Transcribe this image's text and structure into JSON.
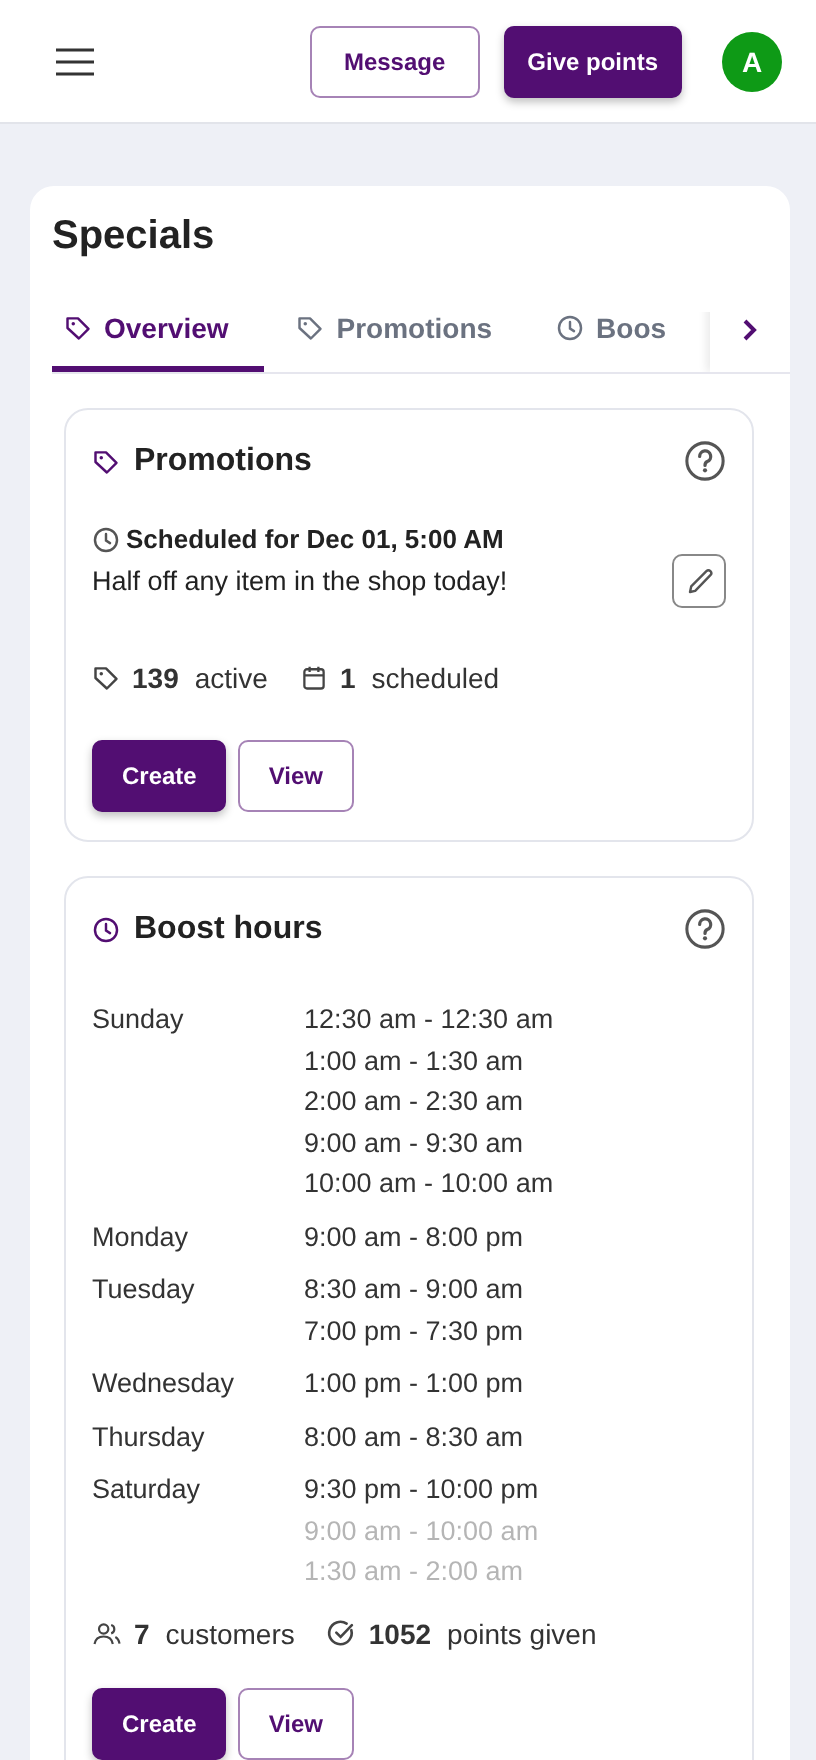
{
  "header": {
    "buttons": [
      {
        "label": "Message",
        "kind": "outline"
      },
      {
        "label": "Give points",
        "kind": "filled"
      }
    ],
    "avatar": "A"
  },
  "title": "Specials",
  "tabs": [
    {
      "label": "Overview",
      "selected": true
    },
    {
      "label": "Promotions",
      "selected": false
    },
    {
      "label": "Boos",
      "selected": false
    }
  ],
  "promotions": {
    "title": "Promotions",
    "scheduled": "Scheduled for Dec 01, 5:00 AM",
    "message": "Half off any item in the shop today!",
    "stats": [
      {
        "count": "139",
        "label": "active"
      },
      {
        "count": "1",
        "label": "scheduled"
      }
    ],
    "buttons": [
      {
        "label": "Create",
        "kind": "filled"
      },
      {
        "label": "View",
        "kind": "outline"
      }
    ]
  },
  "boost_hours": {
    "title": "Boost hours",
    "days": [
      {
        "day": "Sunday",
        "slots": [
          {
            "time": "12:30 am - 12:30 am",
            "faded": false
          },
          {
            "time": "1:00 am - 1:30 am",
            "faded": false
          },
          {
            "time": "2:00 am - 2:30 am",
            "faded": false
          },
          {
            "time": "9:00 am - 9:30 am",
            "faded": false
          },
          {
            "time": "10:00 am - 10:00 am",
            "faded": false
          }
        ]
      },
      {
        "day": "Monday",
        "slots": [
          {
            "time": "9:00 am - 8:00 pm",
            "faded": false
          }
        ]
      },
      {
        "day": "Tuesday",
        "slots": [
          {
            "time": "8:30 am - 9:00 am",
            "faded": false
          },
          {
            "time": "7:00 pm - 7:30 pm",
            "faded": false
          }
        ]
      },
      {
        "day": "Wednesday",
        "slots": [
          {
            "time": "1:00 pm - 1:00 pm",
            "faded": false
          }
        ]
      },
      {
        "day": "Thursday",
        "slots": [
          {
            "time": "8:00 am - 8:30 am",
            "faded": false
          }
        ]
      },
      {
        "day": "Saturday",
        "slots": [
          {
            "time": "9:30 pm - 10:00 pm",
            "faded": false
          },
          {
            "time": "9:00 am - 10:00 am",
            "faded": true
          },
          {
            "time": "1:30 am - 2:00 am",
            "faded": true
          }
        ]
      }
    ],
    "stats": [
      {
        "count": "7",
        "label": "customers"
      },
      {
        "count": "1052",
        "label": "points given"
      }
    ],
    "buttons": [
      {
        "label": "Create",
        "kind": "filled"
      },
      {
        "label": "View",
        "kind": "outline"
      }
    ]
  }
}
